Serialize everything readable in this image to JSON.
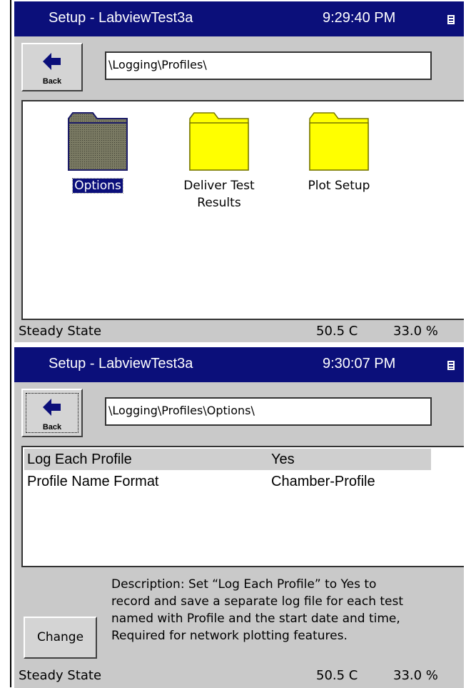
{
  "screens": [
    {
      "title": "Setup - LabviewTest3a",
      "time": "9:29:40 PM",
      "back_label": "Back",
      "path": "\\Logging\\Profiles\\",
      "folders": [
        {
          "label_line1": "Options",
          "label_line2": "",
          "selected": true
        },
        {
          "label_line1": "Deliver Test",
          "label_line2": "Results",
          "selected": false
        },
        {
          "label_line1": "Plot Setup",
          "label_line2": "",
          "selected": false
        }
      ],
      "status": {
        "state": "Steady State",
        "temperature": "50.5 C",
        "humidity": "33.0 %"
      }
    },
    {
      "title": "Setup - LabviewTest3a",
      "time": "9:30:07 PM",
      "back_label": "Back",
      "path": "\\Logging\\Profiles\\Options\\",
      "settings": [
        {
          "name": "Log Each Profile",
          "value": "Yes",
          "selected": true
        },
        {
          "name": "Profile Name Format",
          "value": "Chamber-Profile",
          "selected": false
        }
      ],
      "change_label": "Change",
      "description": [
        "Description:  Set “Log Each Profile” to Yes to",
        "record and save a separate log file for each test",
        "named with Profile and the start date and time,",
        "Required for network plotting features."
      ],
      "status": {
        "state": "Steady State",
        "temperature": "50.5 C",
        "humidity": "33.0 %"
      }
    }
  ],
  "colors": {
    "titlebar": "#0b0f7a",
    "folder_yellow": "#ffff00",
    "folder_selected": "#6b6b58",
    "selection": "#0b0f7a",
    "panel": "#c9c9c9"
  }
}
